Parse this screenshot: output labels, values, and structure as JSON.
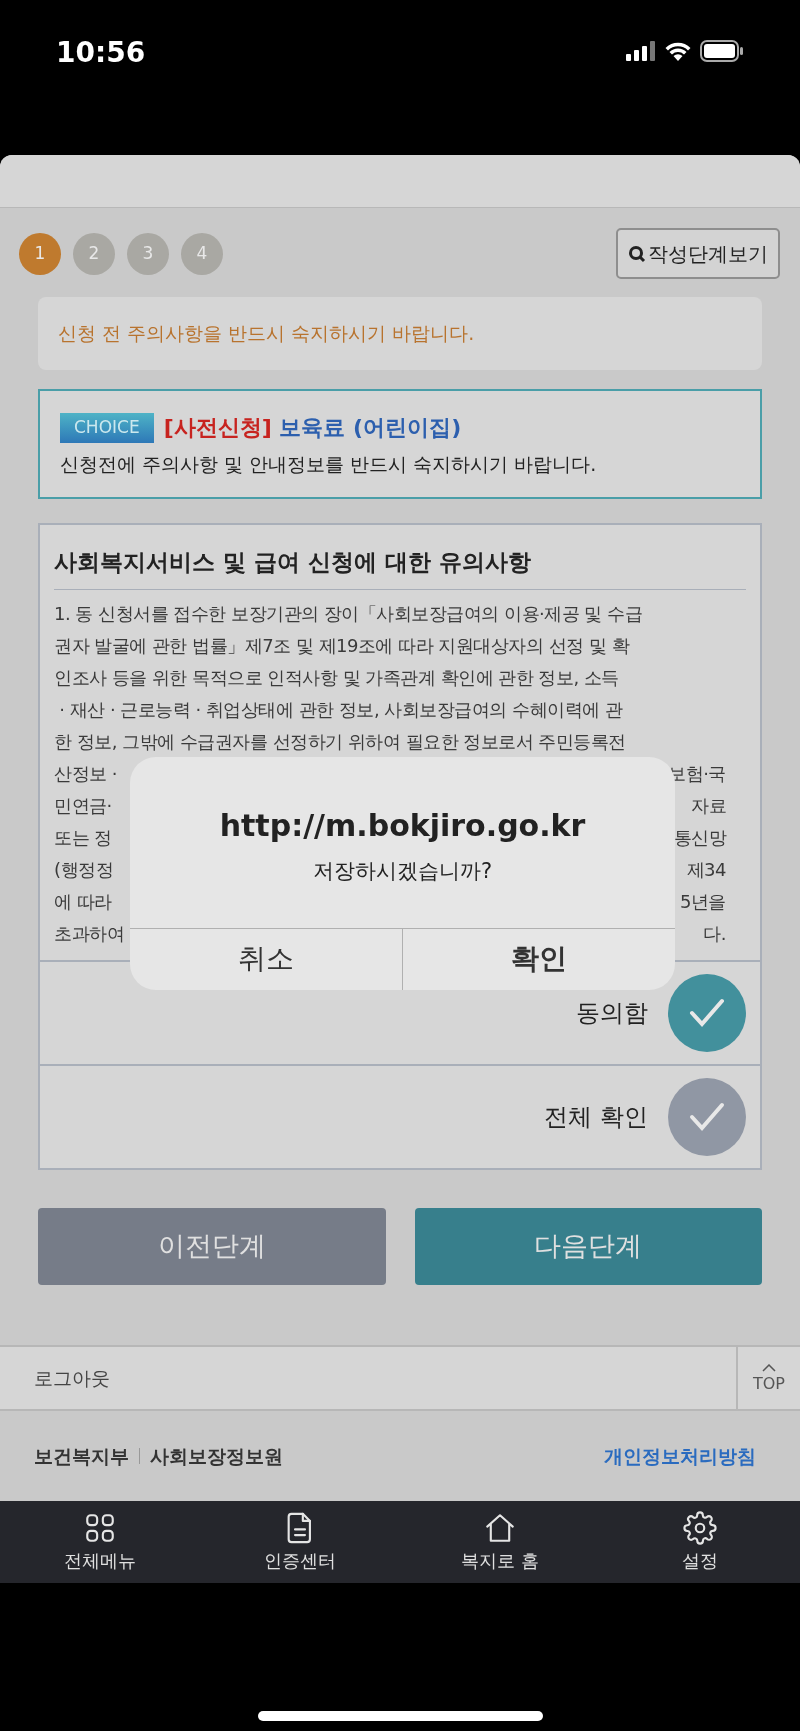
{
  "status_bar": {
    "time": "10:56"
  },
  "steps": [
    {
      "label": "1",
      "selected": true
    },
    {
      "label": "2",
      "selected": false
    },
    {
      "label": "3",
      "selected": false
    },
    {
      "label": "4",
      "selected": false
    }
  ],
  "view_steps_button": "작성단계보기",
  "notice": "신청 전 주의사항을 반드시 숙지하시기 바랍니다.",
  "service": {
    "badge": "CHOICE",
    "tag": "[사전신청]",
    "title": "보육료 (어린이집)",
    "description": "신청전에 주의사항 및 안내정보를 반드시 숙지하시기 바랍니다."
  },
  "terms": {
    "title": "사회복지서비스 및 급여 신청에 대한 유의사항",
    "lines": [
      {
        "kind": "full",
        "text": "1. 동 신청서를 접수한 보장기관의 장이「사회보장급여의 이용·제공 및 수급"
      },
      {
        "kind": "full",
        "text": "권자 발굴에 관한 법률」제7조 및 제19조에 따라 지원대상자의 선정 및 확"
      },
      {
        "kind": "full",
        "text": "인조사 등을 위한 목적으로 인적사항 및 가족관계 확인에 관한 정보, 소득"
      },
      {
        "kind": "full",
        "text": " · 재산 · 근로능력 · 취업상태에 관한 정보, 사회보장급여의 수혜이력에 관"
      },
      {
        "kind": "full",
        "text": "한 정보, 그밖에 수급권자를 선정하기 위하여 필요한 정보로서 주민등록전"
      },
      {
        "kind": "split",
        "left": "산정보 ·",
        "right": "보험·국"
      },
      {
        "kind": "split",
        "left": "민연금·",
        "right": "자료"
      },
      {
        "kind": "split",
        "left": "또는 정",
        "right": "통신망"
      },
      {
        "kind": "split",
        "left": "(행정정",
        "right": "제34"
      },
      {
        "kind": "split",
        "left": "에 따라",
        "right": "5년을"
      },
      {
        "kind": "split",
        "left": "초과하여",
        "right": "다."
      }
    ]
  },
  "checks": [
    {
      "label": "동의함",
      "checked": true
    },
    {
      "label": "전체 확인",
      "checked": false
    }
  ],
  "buttons": [
    {
      "label": "이전단계",
      "kind": "secondary"
    },
    {
      "label": "다음단계",
      "kind": "primary"
    }
  ],
  "logout": "로그아웃",
  "top_button": "TOP",
  "footer": {
    "links": [
      "보건복지부",
      "사회보장정보원"
    ],
    "privacy": "개인정보처리방침"
  },
  "nav": [
    {
      "label": "전체메뉴"
    },
    {
      "label": "인증센터"
    },
    {
      "label": "복지로 홈"
    },
    {
      "label": "설정"
    }
  ],
  "dialog": {
    "title": "http://m.bokjiro.go.kr",
    "message": "저장하시겠습니까?",
    "buttons": [
      "취소",
      "확인"
    ]
  }
}
